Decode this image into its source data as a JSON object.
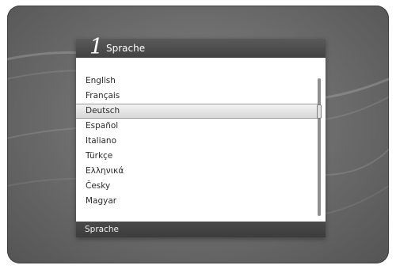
{
  "dialog": {
    "step_number": "1",
    "title": "Sprache",
    "languages": [
      "English",
      "Français",
      "Deutsch",
      "Español",
      "Italiano",
      "Türkçe",
      "Ελληνικά",
      "Česky",
      "Magyar"
    ],
    "selected_language": "Deutsch",
    "footer_label": "Sprache"
  }
}
